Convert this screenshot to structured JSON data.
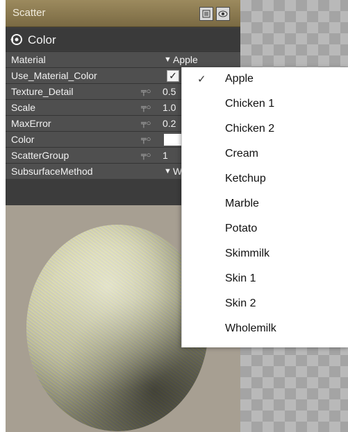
{
  "panel": {
    "title": "Scatter",
    "section_label": "Color",
    "rows": [
      {
        "label": "Material",
        "value": "Apple"
      },
      {
        "label": "Use_Material_Color",
        "value": "✓"
      },
      {
        "label": "Texture_Detail",
        "value": "0.5"
      },
      {
        "label": "Scale",
        "value": "1.0"
      },
      {
        "label": "MaxError",
        "value": "0.2"
      },
      {
        "label": "Color",
        "value": ""
      },
      {
        "label": "ScatterGroup",
        "value": "1"
      },
      {
        "label": "SubsurfaceMethod",
        "value": "W"
      }
    ]
  },
  "menu": {
    "selected": "Apple",
    "items": [
      "Apple",
      "Chicken 1",
      "Chicken 2",
      "Cream",
      "Ketchup",
      "Marble",
      "Potato",
      "Skimmilk",
      "Skin 1",
      "Skin 2",
      "Wholemilk"
    ]
  },
  "colors": {
    "titlebar": "#8c7a50",
    "panel": "#3c3c3c",
    "row": "#4f4f4f",
    "preview_bg": "#a79f92"
  }
}
